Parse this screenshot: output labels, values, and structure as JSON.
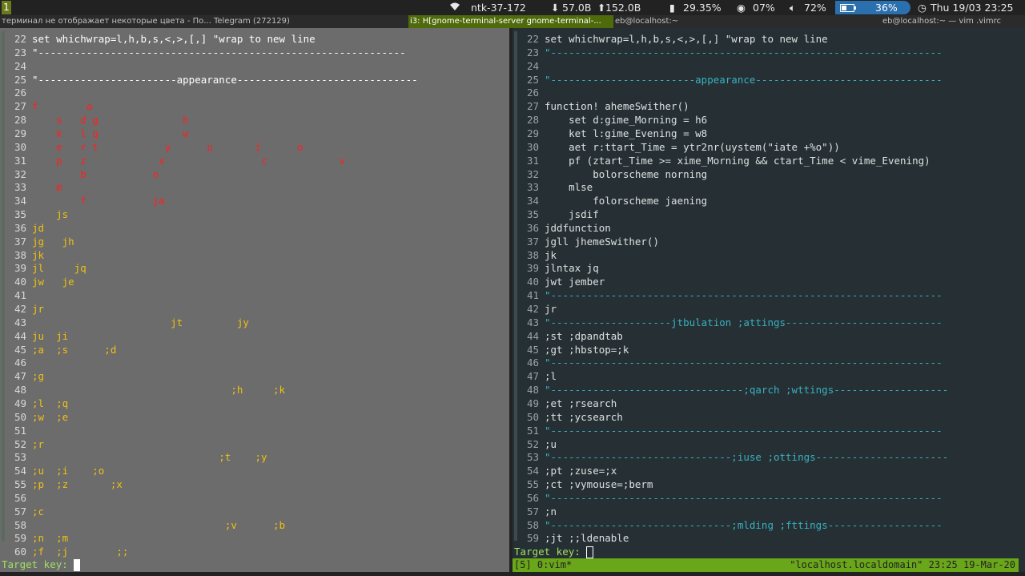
{
  "topbar": {
    "workspace": "1",
    "host": "ntk-37-172",
    "down": "57.0B",
    "up": "152.0B",
    "cpu": "29.35%",
    "disk": "07%",
    "volume": "72%",
    "battery": "36%",
    "datetime": "Thu 19/03 23:25",
    "wifi_icon": "wifi-icon",
    "down_icon": "download-arrow-icon",
    "up_icon": "upload-arrow-icon"
  },
  "windows": {
    "t1": "терминал не отображает некоторые цвета - По... Telegram (272129)",
    "t2": "i3: H[gnome-terminal-server gnome-terminal-...",
    "t3": "eb@localhost:~",
    "t4": "eb@localhost:~ — vim .vimrc"
  },
  "left": {
    "target_label": "Target key:",
    "lines": [
      {
        "n": "22",
        "t": "set whichwrap=l,h,b,s,<,>,[,] \"wrap to new line"
      },
      {
        "n": "23",
        "t": "\"-------------------------------------------------------------"
      },
      {
        "n": "24",
        "t": ""
      },
      {
        "n": "25",
        "t": "\"-----------------------appearance------------------------------"
      },
      {
        "n": "26",
        "t": ""
      },
      {
        "n": "27",
        "t": "f        a"
      },
      {
        "n": "28",
        "t": "    s   d g              h"
      },
      {
        "n": "29",
        "t": "    k   l q              w"
      },
      {
        "n": "30",
        "t": "    e   r t           y      u       i      o"
      },
      {
        "n": "31",
        "t": "    p   z            x                c            v"
      },
      {
        "n": "32",
        "t": "        b           n"
      },
      {
        "n": "33",
        "t": "    m"
      },
      {
        "n": "34",
        "t": "        f           ja"
      },
      {
        "n": "35",
        "t": "    js"
      },
      {
        "n": "36",
        "t": "jd"
      },
      {
        "n": "37",
        "t": "jg   jh"
      },
      {
        "n": "38",
        "t": "jk"
      },
      {
        "n": "39",
        "t": "jl     jq"
      },
      {
        "n": "40",
        "t": "jw   je"
      },
      {
        "n": "41",
        "t": ""
      },
      {
        "n": "42",
        "t": "jr"
      },
      {
        "n": "43",
        "t": "                       jt         jy"
      },
      {
        "n": "44",
        "t": "ju  ji"
      },
      {
        "n": "45",
        "t": ";a  ;s      ;d"
      },
      {
        "n": "46",
        "t": ""
      },
      {
        "n": "47",
        "t": ";g"
      },
      {
        "n": "48",
        "t": "                                 ;h     ;k"
      },
      {
        "n": "49",
        "t": ";l  ;q"
      },
      {
        "n": "50",
        "t": ";w  ;e"
      },
      {
        "n": "51",
        "t": ""
      },
      {
        "n": "52",
        "t": ";r"
      },
      {
        "n": "53",
        "t": "                               ;t    ;y"
      },
      {
        "n": "54",
        "t": ";u  ;i    ;o"
      },
      {
        "n": "55",
        "t": ";p  ;z       ;x"
      },
      {
        "n": "56",
        "t": ""
      },
      {
        "n": "57",
        "t": ";c"
      },
      {
        "n": "58",
        "t": "                                ;v      ;b"
      },
      {
        "n": "59",
        "t": ";n  ;m"
      },
      {
        "n": "60",
        "t": ";f  ;j        ;;"
      }
    ]
  },
  "right": {
    "target_label": "Target key:",
    "status_left": "[5] 0:vim*",
    "status_right": "\"localhost.localdomain\" 23:25 19-Mar-20",
    "lines": [
      {
        "n": "22",
        "t": "set whichwrap=l,h,b,s,<,>,[,] \"wrap to new line"
      },
      {
        "n": "23",
        "t": "\"-----------------------------------------------------------------"
      },
      {
        "n": "24",
        "t": ""
      },
      {
        "n": "25",
        "t": "\"------------------------appearance-------------------------------"
      },
      {
        "n": "26",
        "t": ""
      },
      {
        "n": "27",
        "t": "function! ahemeSwither()"
      },
      {
        "n": "28",
        "t": "    set d:gime_Morning = h6"
      },
      {
        "n": "29",
        "t": "    ket l:gime_Evening = w8"
      },
      {
        "n": "30",
        "t": "    aet r:ttart_Time = ytr2nr(uystem(\"iate +%o\"))"
      },
      {
        "n": "31",
        "t": "    pf (ztart_Time >= xime_Morning && ctart_Time < vime_Evening)"
      },
      {
        "n": "32",
        "t": "        bolorscheme norning"
      },
      {
        "n": "33",
        "t": "    mlse"
      },
      {
        "n": "34",
        "t": "        folorscheme jaening"
      },
      {
        "n": "35",
        "t": "    jsdif"
      },
      {
        "n": "36",
        "t": "jddfunction"
      },
      {
        "n": "37",
        "t": "jgll jhemeSwither()"
      },
      {
        "n": "38",
        "t": "jk"
      },
      {
        "n": "39",
        "t": "jlntax jq"
      },
      {
        "n": "40",
        "t": "jwt jember"
      },
      {
        "n": "41",
        "t": "\"-----------------------------------------------------------------"
      },
      {
        "n": "42",
        "t": "jr"
      },
      {
        "n": "43",
        "t": "\"--------------------jtbulation ;attings--------------------------"
      },
      {
        "n": "44",
        "t": ";st ;dpandtab"
      },
      {
        "n": "45",
        "t": ";gt ;hbstop=;k"
      },
      {
        "n": "46",
        "t": "\"-----------------------------------------------------------------"
      },
      {
        "n": "47",
        "t": ";l"
      },
      {
        "n": "48",
        "t": "\"--------------------------------;qarch ;wttings-------------------"
      },
      {
        "n": "49",
        "t": ";et ;rsearch"
      },
      {
        "n": "50",
        "t": ";tt ;ycsearch"
      },
      {
        "n": "51",
        "t": "\"-----------------------------------------------------------------"
      },
      {
        "n": "52",
        "t": ";u"
      },
      {
        "n": "53",
        "t": "\"------------------------------;iuse ;ottings----------------------"
      },
      {
        "n": "54",
        "t": ";pt ;zuse=;x"
      },
      {
        "n": "55",
        "t": ";ct ;vymouse=;berm"
      },
      {
        "n": "56",
        "t": "\"-----------------------------------------------------------------"
      },
      {
        "n": "57",
        "t": ";n"
      },
      {
        "n": "58",
        "t": "\"------------------------------;mlding ;fttings-------------------"
      },
      {
        "n": "59",
        "t": ";jt ;;ldenable"
      }
    ]
  }
}
